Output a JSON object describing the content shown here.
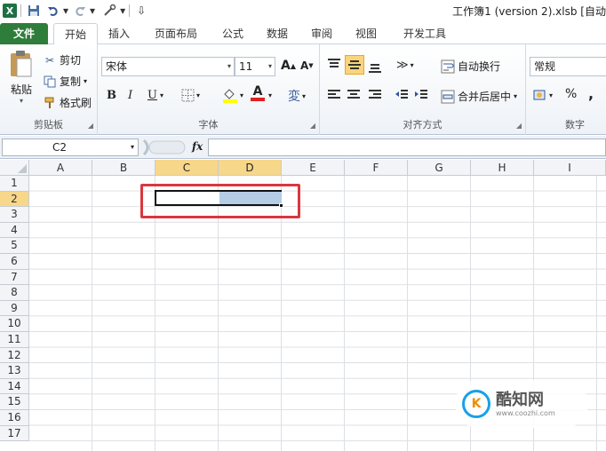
{
  "window": {
    "title": "工作簿1 (version 2).xlsb [自动"
  },
  "quick_access": {
    "app_icon": "excel-logo",
    "save_icon": "save-icon",
    "undo_icon": "undo-icon",
    "redo_icon": "redo-icon",
    "customize_icon": "customize-icon"
  },
  "tabs": {
    "file": "文件",
    "items": [
      "开始",
      "插入",
      "页面布局",
      "公式",
      "数据",
      "审阅",
      "视图",
      "开发工具"
    ],
    "active_index": 0
  },
  "ribbon": {
    "clipboard": {
      "paste": "粘贴",
      "cut": "剪切",
      "copy": "复制",
      "format_painter": "格式刷",
      "label": "剪贴板"
    },
    "font": {
      "font_name": "宋体",
      "font_size": "11",
      "grow": "A",
      "shrink": "A",
      "bold": "B",
      "italic": "I",
      "underline": "U",
      "phonetic": "変",
      "font_color_letter": "A",
      "label": "字体"
    },
    "alignment": {
      "wrap_text": "自动换行",
      "merge_center": "合并后居中",
      "label": "对齐方式"
    },
    "number": {
      "format": "常规",
      "percent": "%",
      "comma": ",",
      "label": "数字"
    }
  },
  "formula_bar": {
    "name_box": "C2",
    "fx": "fx",
    "value": ""
  },
  "sheet": {
    "columns": [
      "A",
      "B",
      "C",
      "D",
      "E",
      "F",
      "G",
      "H",
      "I"
    ],
    "rows": [
      "1",
      "2",
      "3",
      "4",
      "5",
      "6",
      "7",
      "8",
      "9",
      "10",
      "11",
      "12",
      "13",
      "14",
      "15",
      "16",
      "17"
    ],
    "selected_columns": [
      "C",
      "D"
    ],
    "selected_row": "2",
    "selection": "C2:D2"
  },
  "watermark": {
    "name": "酷知网",
    "url": "www.coozhi.com"
  },
  "colors": {
    "file_tab": "#2f7d3b",
    "header_selected": "#f7d78a",
    "selection_fill": "#b5cce6",
    "highlight_box": "#d9373f"
  }
}
